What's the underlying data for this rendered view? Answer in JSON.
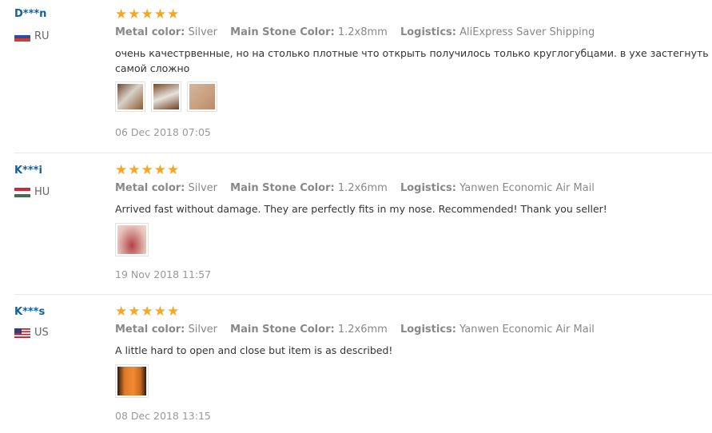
{
  "reviews": [
    {
      "user": "D***n",
      "country": "RU",
      "flag": "ru-flag",
      "rating": 5,
      "attrs": [
        {
          "key": "Metal color:",
          "value": "Silver"
        },
        {
          "key": "Main Stone Color:",
          "value": "1.2x8mm"
        },
        {
          "key": "Logistics:",
          "value": "AliExpress Saver Shipping"
        }
      ],
      "feedback": "очень качестрвенные, но на столько плотные что открыть получилось только круглогубцами. в ухе застегнуть самой сложно",
      "photos": 3,
      "date": "06 Dec 2018 07:05"
    },
    {
      "user": "K***i",
      "country": "HU",
      "flag": "hu-flag",
      "rating": 5,
      "attrs": [
        {
          "key": "Metal color:",
          "value": "Silver"
        },
        {
          "key": "Main Stone Color:",
          "value": "1.2x6mm"
        },
        {
          "key": "Logistics:",
          "value": "Yanwen Economic Air Mail"
        }
      ],
      "feedback": "Arrived fast without damage. They are perfectly fits in my nose. Recommended! Thank you seller!",
      "photos": 1,
      "date": "19 Nov 2018 11:57"
    },
    {
      "user": "K***s",
      "country": "US",
      "flag": "us-flag",
      "rating": 5,
      "attrs": [
        {
          "key": "Metal color:",
          "value": "Silver"
        },
        {
          "key": "Main Stone Color:",
          "value": "1.2x6mm"
        },
        {
          "key": "Logistics:",
          "value": "Yanwen Economic Air Mail"
        }
      ],
      "feedback": "A little hard to open and close but item is as described!",
      "photos": 1,
      "date": "08 Dec 2018 13:15"
    }
  ],
  "colors": {
    "star": "#f5a623",
    "user_link": "#0c61a8"
  }
}
